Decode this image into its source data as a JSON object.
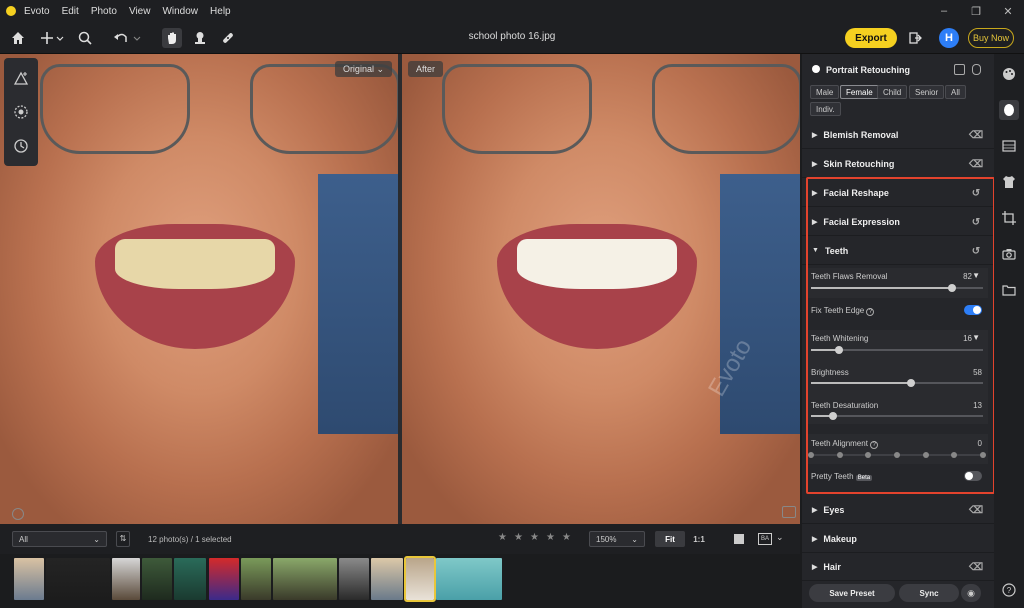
{
  "menubar": {
    "app_name": "Evoto",
    "menu": [
      "Edit",
      "Photo",
      "View",
      "Window",
      "Help"
    ]
  },
  "toolbar": {
    "document_title": "school photo 16.jpg",
    "export_label": "Export",
    "avatar_initial": "H",
    "buy_label": "Buy Now"
  },
  "canvas": {
    "original_label": "Original",
    "after_label": "After",
    "watermark": "Evoto"
  },
  "panel": {
    "header_title": "Portrait Retouching",
    "chips": [
      "Male",
      "Female",
      "Child",
      "Senior",
      "All",
      "Indiv."
    ],
    "selected_chip": "Female",
    "sections": {
      "blemish": "Blemish Removal",
      "skin": "Skin Retouching",
      "reshape": "Facial Reshape",
      "expression": "Facial Expression",
      "teeth": "Teeth",
      "eyes": "Eyes",
      "makeup": "Makeup",
      "hair": "Hair"
    },
    "teeth": {
      "flaws_label": "Teeth Flaws Removal",
      "flaws_value": "82",
      "fix_edge_label": "Fix Teeth Edge",
      "fix_edge_on": true,
      "whitening_label": "Teeth Whitening",
      "whitening_value": "16",
      "brightness_label": "Brightness",
      "brightness_value": "58",
      "desat_label": "Teeth Desaturation",
      "desat_value": "13",
      "alignment_label": "Teeth Alignment",
      "alignment_value": "0",
      "pretty_label": "Pretty Teeth",
      "pretty_badge": "Beta",
      "pretty_on": false
    },
    "save_preset_label": "Save Preset",
    "sync_label": "Sync"
  },
  "filmbar": {
    "filter_value": "All",
    "photo_count": "12 photo(s) / 1 selected",
    "zoom_value": "150%",
    "fit_label": "Fit",
    "one_to_one_label": "1:1"
  },
  "colors": {
    "accent_yellow": "#f5d020",
    "highlight_red": "#e3432d",
    "toggle_blue": "#2d7ef7"
  }
}
